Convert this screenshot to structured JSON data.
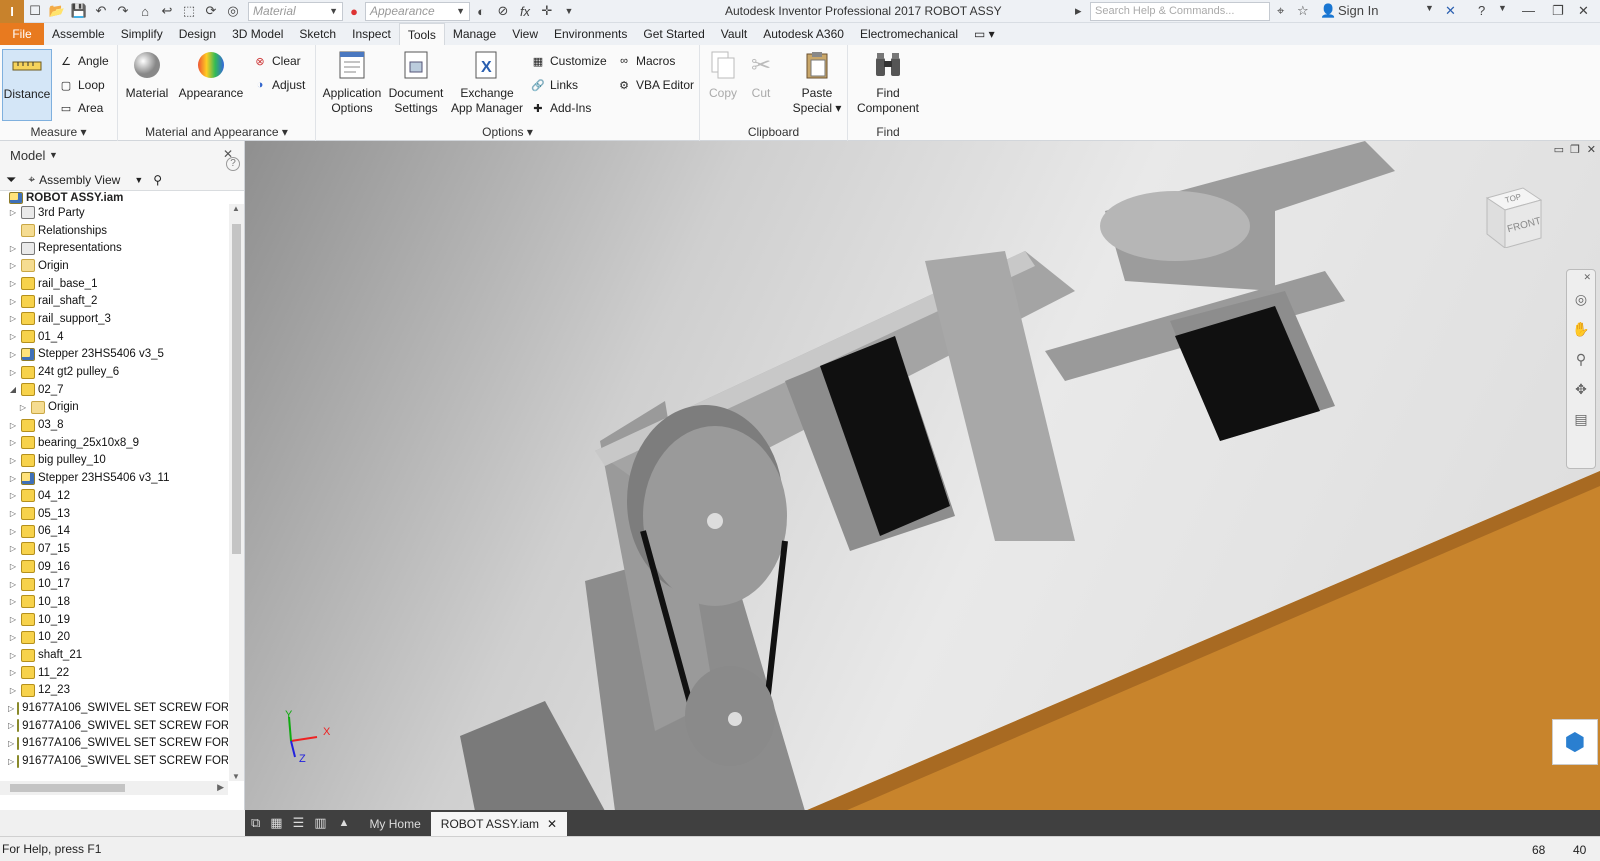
{
  "app": {
    "logo_text": "I",
    "title": "Autodesk Inventor Professional 2017   ROBOT ASSY",
    "search_placeholder": "Search Help & Commands...",
    "sign_in": "Sign In"
  },
  "qat": {
    "material_placeholder": "Material",
    "appearance_placeholder": "Appearance"
  },
  "tabs": [
    {
      "label": "File"
    },
    {
      "label": "Assemble"
    },
    {
      "label": "Simplify"
    },
    {
      "label": "Design"
    },
    {
      "label": "3D Model"
    },
    {
      "label": "Sketch"
    },
    {
      "label": "Inspect"
    },
    {
      "label": "Tools"
    },
    {
      "label": "Manage"
    },
    {
      "label": "View"
    },
    {
      "label": "Environments"
    },
    {
      "label": "Get Started"
    },
    {
      "label": "Vault"
    },
    {
      "label": "Autodesk A360"
    },
    {
      "label": "Electromechanical"
    }
  ],
  "ribbon": {
    "measure": {
      "label": "Measure",
      "distance": "Distance",
      "angle": "Angle",
      "loop": "Loop",
      "area": "Area"
    },
    "material_appearance": {
      "label": "Material and Appearance",
      "material": "Material",
      "appearance": "Appearance",
      "clear": "Clear",
      "adjust": "Adjust"
    },
    "options": {
      "label": "Options",
      "app_options_1": "Application",
      "app_options_2": "Options",
      "doc_settings_1": "Document",
      "doc_settings_2": "Settings",
      "exchange_1": "Exchange",
      "exchange_2": "App Manager",
      "customize": "Customize",
      "links": "Links",
      "addins": "Add-Ins",
      "macros": "Macros",
      "vba": "VBA Editor"
    },
    "clipboard": {
      "label": "Clipboard",
      "copy": "Copy",
      "cut": "Cut",
      "paste_1": "Paste",
      "paste_2": "Special"
    },
    "find": {
      "label": "Find",
      "find_1": "Find",
      "find_2": "Component"
    }
  },
  "browser": {
    "title": "Model",
    "view": "Assembly View",
    "root": "ROBOT ASSY.iam",
    "nodes": [
      {
        "label": "3rd Party",
        "icon": "rep",
        "tw": "▷",
        "indent": 0
      },
      {
        "label": "Relationships",
        "icon": "folder",
        "tw": "",
        "indent": 0
      },
      {
        "label": "Representations",
        "icon": "rep",
        "tw": "▷",
        "indent": 0
      },
      {
        "label": "Origin",
        "icon": "folder",
        "tw": "▷",
        "indent": 0
      },
      {
        "label": "rail_base_1",
        "icon": "part",
        "tw": "▷",
        "indent": 0
      },
      {
        "label": "rail_shaft_2",
        "icon": "part",
        "tw": "▷",
        "indent": 0
      },
      {
        "label": "rail_support_3",
        "icon": "part",
        "tw": "▷",
        "indent": 0
      },
      {
        "label": "01_4",
        "icon": "part",
        "tw": "▷",
        "indent": 0
      },
      {
        "label": "Stepper 23HS5406 v3_5",
        "icon": "asm",
        "tw": "▷",
        "indent": 0
      },
      {
        "label": "24t gt2 pulley_6",
        "icon": "part",
        "tw": "▷",
        "indent": 0
      },
      {
        "label": "02_7",
        "icon": "part",
        "tw": "◢",
        "indent": 0
      },
      {
        "label": "Origin",
        "icon": "folder",
        "tw": "▷",
        "indent": 1
      },
      {
        "label": "03_8",
        "icon": "part",
        "tw": "▷",
        "indent": 0
      },
      {
        "label": "bearing_25x10x8_9",
        "icon": "part",
        "tw": "▷",
        "indent": 0
      },
      {
        "label": "big pulley_10",
        "icon": "part",
        "tw": "▷",
        "indent": 0
      },
      {
        "label": "Stepper 23HS5406 v3_11",
        "icon": "asm",
        "tw": "▷",
        "indent": 0
      },
      {
        "label": "04_12",
        "icon": "part",
        "tw": "▷",
        "indent": 0
      },
      {
        "label": "05_13",
        "icon": "part",
        "tw": "▷",
        "indent": 0
      },
      {
        "label": "06_14",
        "icon": "part",
        "tw": "▷",
        "indent": 0
      },
      {
        "label": "07_15",
        "icon": "part",
        "tw": "▷",
        "indent": 0
      },
      {
        "label": "09_16",
        "icon": "part",
        "tw": "▷",
        "indent": 0
      },
      {
        "label": "10_17",
        "icon": "part",
        "tw": "▷",
        "indent": 0
      },
      {
        "label": "10_18",
        "icon": "part",
        "tw": "▷",
        "indent": 0
      },
      {
        "label": "10_19",
        "icon": "part",
        "tw": "▷",
        "indent": 0
      },
      {
        "label": "10_20",
        "icon": "part",
        "tw": "▷",
        "indent": 0
      },
      {
        "label": "shaft_21",
        "icon": "part",
        "tw": "▷",
        "indent": 0
      },
      {
        "label": "11_22",
        "icon": "part",
        "tw": "▷",
        "indent": 0
      },
      {
        "label": "12_23",
        "icon": "part",
        "tw": "▷",
        "indent": 0
      },
      {
        "label": "91677A106_SWIVEL SET SCREW FOR",
        "icon": "screw",
        "tw": "▷",
        "indent": 0
      },
      {
        "label": "91677A106_SWIVEL SET SCREW FOR",
        "icon": "screw",
        "tw": "▷",
        "indent": 0
      },
      {
        "label": "91677A106_SWIVEL SET SCREW FOR",
        "icon": "screw",
        "tw": "▷",
        "indent": 0
      },
      {
        "label": "91677A106_SWIVEL SET SCREW FOR",
        "icon": "screw",
        "tw": "▷",
        "indent": 0
      }
    ]
  },
  "viewcube": {
    "top": "TOP",
    "front": "FRONT"
  },
  "triad": {
    "x": "X",
    "y": "Y",
    "z": "Z"
  },
  "doc_tabs": {
    "home": "My Home",
    "active": "ROBOT ASSY.iam"
  },
  "status": {
    "help": "For Help, press F1",
    "count1": "68",
    "count2": "40"
  },
  "colors": {
    "file_tab": "#e87a1f",
    "motor_black": "#101010",
    "wood": "#c8842c",
    "metal": "#8c8c8c"
  }
}
